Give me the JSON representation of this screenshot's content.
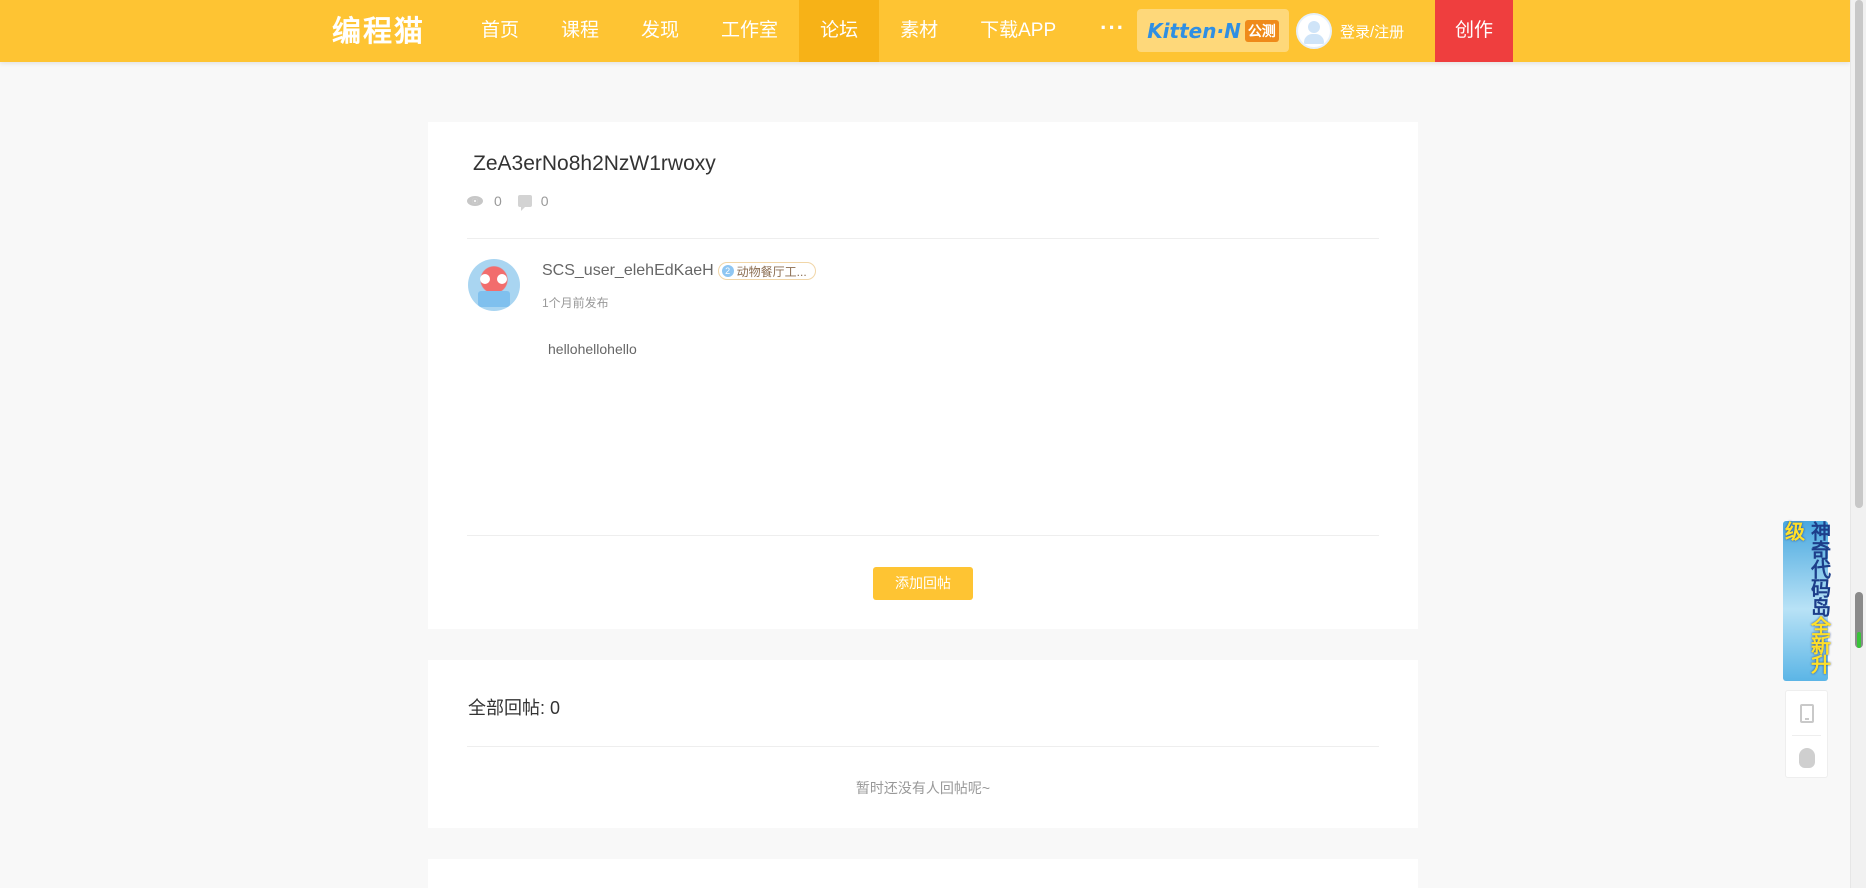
{
  "header": {
    "logo": "编程猫",
    "nav": [
      {
        "label": "首页",
        "active": false
      },
      {
        "label": "课程",
        "active": false
      },
      {
        "label": "发现",
        "active": false
      },
      {
        "label": "工作室",
        "active": false
      },
      {
        "label": "论坛",
        "active": true
      },
      {
        "label": "素材",
        "active": false
      },
      {
        "label": "下载APP",
        "active": false
      }
    ],
    "more": "···",
    "kitten_logo": "Kitten·N",
    "kitten_tag": "公测",
    "login": "登录/注册",
    "create": "创作"
  },
  "post": {
    "title": "ZeA3erNo8h2NzW1rwoxy",
    "views": "0",
    "comments": "0",
    "author": "SCS_user_elehEdKaeH",
    "badge_level": "2",
    "badge": "动物餐厅工...",
    "time": "1个月前发布",
    "body": "hellohellohello",
    "reply_button": "添加回帖"
  },
  "replies": {
    "title": "全部回帖: 0",
    "empty": "暂时还没有人回帖呢~"
  },
  "promo": {
    "text_a": "神奇代码岛",
    "text_b": "全新升级"
  },
  "colors": {
    "brand": "#fec433",
    "nav_active": "#f7b217",
    "create": "#ef3e3e"
  }
}
